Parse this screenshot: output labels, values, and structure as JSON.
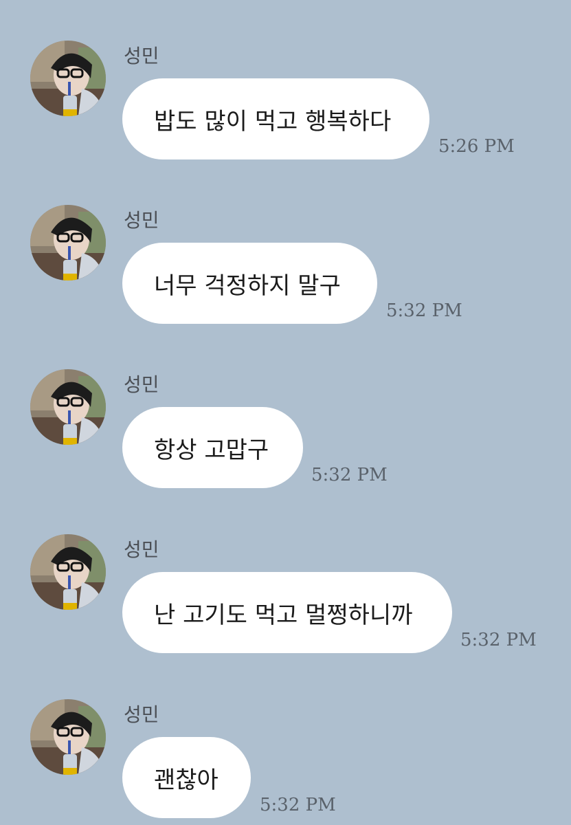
{
  "messages": [
    {
      "sender": "성민",
      "text": "밥도 많이 먹고 행복하다",
      "time": "5:26 PM"
    },
    {
      "sender": "성민",
      "text": "너무 걱정하지 말구",
      "time": "5:32 PM"
    },
    {
      "sender": "성민",
      "text": "항상 고맙구",
      "time": "5:32 PM"
    },
    {
      "sender": "성민",
      "text": "난 고기도 먹고 멀쩡하니까",
      "time": "5:32 PM"
    },
    {
      "sender": "성민",
      "text": "괜찮아",
      "time": "5:32 PM"
    }
  ],
  "colors": {
    "background": "#aebfcf",
    "bubble": "#ffffff",
    "text": "#1b1b1b",
    "sender": "#4b4f55",
    "time": "#5a626b"
  },
  "icons": {
    "avatar": "profile-photo"
  }
}
